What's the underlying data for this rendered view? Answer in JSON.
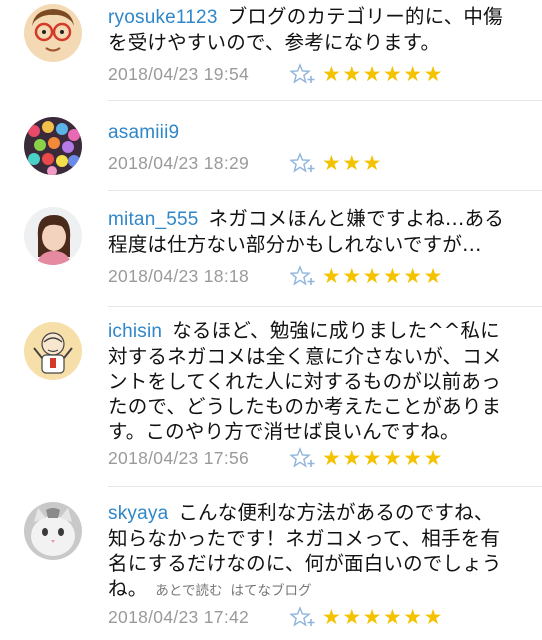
{
  "comments": [
    {
      "user": "ryosuke1123",
      "text": "ブログのカテゴリー的に、中傷を受けやすいので、参考になります。",
      "date": "2018/04/23 19:54",
      "stars": "★★★★★★"
    },
    {
      "user": "asamiii9",
      "text": "",
      "date": "2018/04/23 18:29",
      "stars": "★★★"
    },
    {
      "user": "mitan_555",
      "text": "ネガコメほんと嫌ですよね…ある程度は仕方ない部分かもしれないですが…",
      "date": "2018/04/23 18:18",
      "stars": "★★★★★★"
    },
    {
      "user": "ichisin",
      "text": "なるほど、勉強に成りました^^私に対するネガコメは全く意に介さないが、コメントをしてくれた人に対するものが以前あったので、どうしたものか考えたことがあります。このやり方で消せば良いんですね。",
      "date": "2018/04/23 17:56",
      "stars": "★★★★★★"
    },
    {
      "user": "skyaya",
      "text": "こんな便利な方法があるのですね、知らなかったです！ネガコメって、相手を有名にするだけなのに、何が面白いのでしょうね。",
      "extra_read_later": "あとで読む",
      "extra_hatena_blog": "はてなブログ",
      "date": "2018/04/23 17:42",
      "stars": "★★★★★★"
    }
  ],
  "colors": {
    "username": "#2f86c8",
    "date": "#9a9a9a",
    "star": "#f5c200",
    "add_star_icon": "#8fb4dd"
  },
  "icons": {
    "add_star": "add-star-icon"
  }
}
